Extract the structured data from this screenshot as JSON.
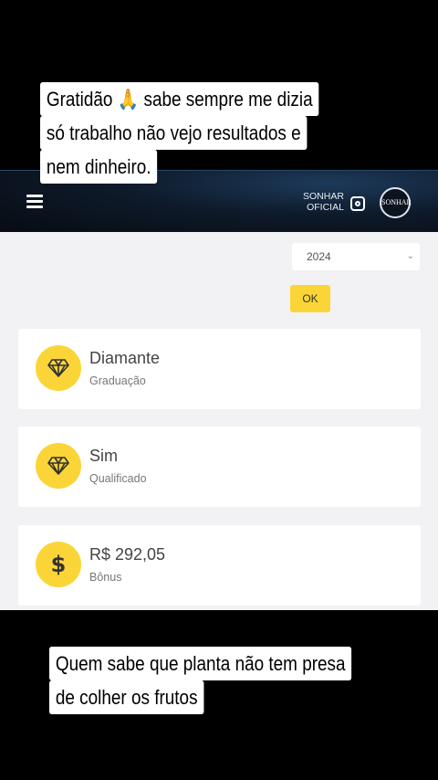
{
  "caption_top": {
    "line1": "Gratidão 🙏 sabe sempre me dizia",
    "line2": "só trabalho não vejo resultados e",
    "line3": "nem dinheiro."
  },
  "caption_bottom": {
    "line1": "Quem sabe que planta não tem presa",
    "line2": "de colher os frutos"
  },
  "header": {
    "brand_line1": "SONHAR",
    "brand_line2": "OFICIAL",
    "logo_text": "SONHAR"
  },
  "filter": {
    "year_selected": "2024",
    "ok_label": "OK"
  },
  "cards": [
    {
      "title": "Diamante",
      "subtitle": "Graduação",
      "icon": "diamond-icon"
    },
    {
      "title": "Sim",
      "subtitle": "Qualificado",
      "icon": "diamond-icon"
    },
    {
      "title": "R$ 292,05",
      "subtitle": "Bônus",
      "icon": "dollar-icon",
      "symbol": "$"
    }
  ],
  "colors": {
    "accent_yellow": "#fbd537",
    "header_dark": "#0e1a2a",
    "content_bg": "#f2f2f4"
  }
}
